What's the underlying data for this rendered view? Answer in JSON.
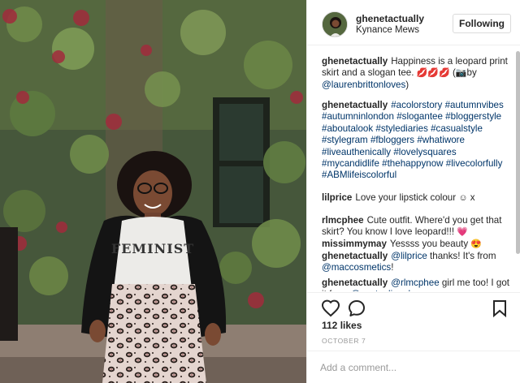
{
  "post": {
    "username": "ghenetactually",
    "location": "Kynance Mews",
    "follow_button": "Following",
    "photo_shirt_text": "FEMINIST"
  },
  "comments": [
    {
      "user": "ghenetactually",
      "parts": [
        {
          "text": "Happiness is a leopard print skirt and a slogan tee. "
        },
        {
          "text": "💋💋💋",
          "emoji": true
        },
        {
          "text": " ("
        },
        {
          "text": "📷",
          "emoji": true
        },
        {
          "text": "by "
        },
        {
          "text": "@laurenbrittonloves",
          "link": true
        },
        {
          "text": ")"
        }
      ]
    },
    {
      "user": "ghenetactually",
      "hashtags": [
        "#acolorstory",
        "#autumnvibes",
        "#autumninlondon",
        "#slogantee",
        "#bloggerstyle",
        "#aboutalook",
        "#stylediaries",
        "#casualstyle",
        "#stylegram",
        "#fbloggers",
        "#whatiwore",
        "#liveauthenically",
        "#lovelysquares",
        "#mycandidlife",
        "#thehappynow",
        "#livecolorfully",
        "#ABMlifeiscolorful"
      ]
    },
    {
      "user": "lilprice",
      "parts": [
        {
          "text": "Love your lipstick colour "
        },
        {
          "text": "☺",
          "emoji": true
        },
        {
          "text": " x"
        }
      ]
    },
    {
      "user": "rlmcphee",
      "parts": [
        {
          "text": "Cute outfit. Where'd you get that skirt? You know I love leopard!!! "
        },
        {
          "text": "💗",
          "emoji": true
        }
      ]
    },
    {
      "user": "missimmymay",
      "parts": [
        {
          "text": "Yessss you beauty "
        },
        {
          "text": "😍",
          "emoji": true
        }
      ]
    },
    {
      "user": "ghenetactually",
      "parts": [
        {
          "text": "@lilprice",
          "link": true
        },
        {
          "text": " thanks! It's from "
        },
        {
          "text": "@maccosmetics",
          "link": true
        },
        {
          "text": "!"
        }
      ]
    },
    {
      "user": "ghenetactually",
      "parts": [
        {
          "text": "@rlmcphee",
          "link": true
        },
        {
          "text": " girl me too! I got it from "
        },
        {
          "text": "@nextonlineuk",
          "link": true
        },
        {
          "text": " x"
        }
      ]
    }
  ],
  "actions": {
    "like_icon": "heart-icon",
    "comment_icon": "comment-bubble-icon",
    "save_icon": "bookmark-icon",
    "likes_text": "112 likes",
    "date_text": "OCTOBER 7"
  },
  "add_comment": {
    "placeholder": "Add a comment..."
  },
  "colors": {
    "link": "#003569",
    "text": "#262626",
    "muted": "#999999",
    "border": "#efefef",
    "heart_lips": "#d6102a"
  }
}
